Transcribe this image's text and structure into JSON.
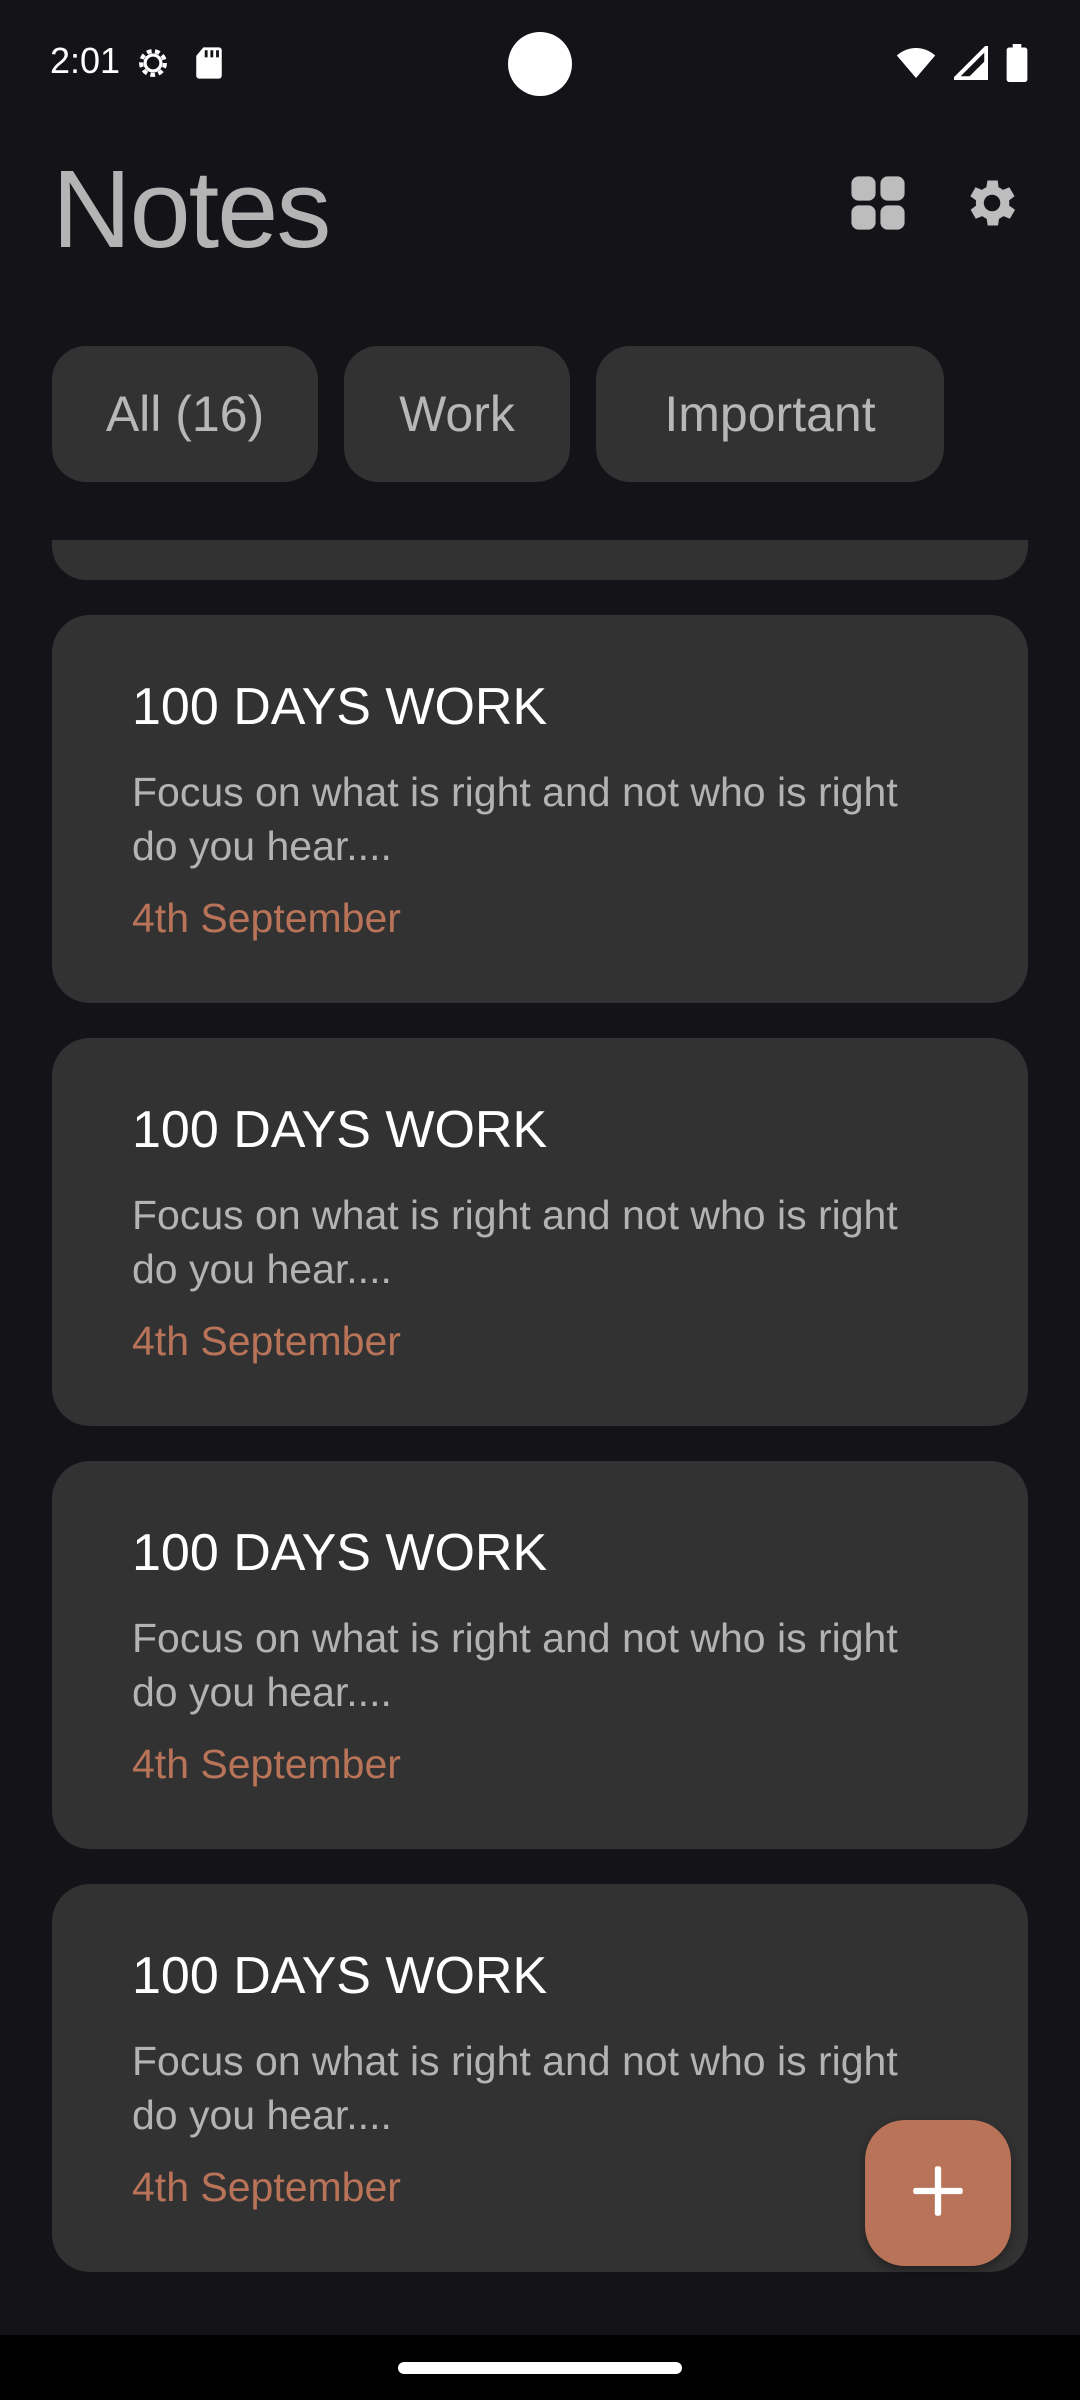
{
  "status_bar": {
    "time": "2:01",
    "left_icons": [
      "settings-gear-icon",
      "sd-card-icon"
    ],
    "right_icons": [
      "wifi-icon",
      "signal-icon",
      "battery-icon"
    ]
  },
  "header": {
    "title": "Notes",
    "grid_icon": "grid-view-icon",
    "settings_icon": "settings-gear-icon"
  },
  "filters": [
    {
      "label": "All (16)"
    },
    {
      "label": "Work"
    },
    {
      "label": "Important"
    }
  ],
  "notes": [
    {
      "title": "100 DAYS WORK",
      "body": "Focus on what is right and not who is right do you hear....",
      "date": "4th September"
    },
    {
      "title": "100 DAYS WORK",
      "body": "Focus on what is right and not who is right do you hear....",
      "date": "4th September"
    },
    {
      "title": "100 DAYS WORK",
      "body": "Focus on what is right and not who is right do you hear....",
      "date": "4th September"
    },
    {
      "title": "100 DAYS WORK",
      "body": "Focus on what is right and not who is right do you hear....",
      "date": "4th September"
    }
  ],
  "fab": {
    "icon": "plus-icon"
  },
  "colors": {
    "background": "#141318",
    "card": "#323232",
    "accent": "#b87358",
    "title_text": "#b4b4b4"
  }
}
